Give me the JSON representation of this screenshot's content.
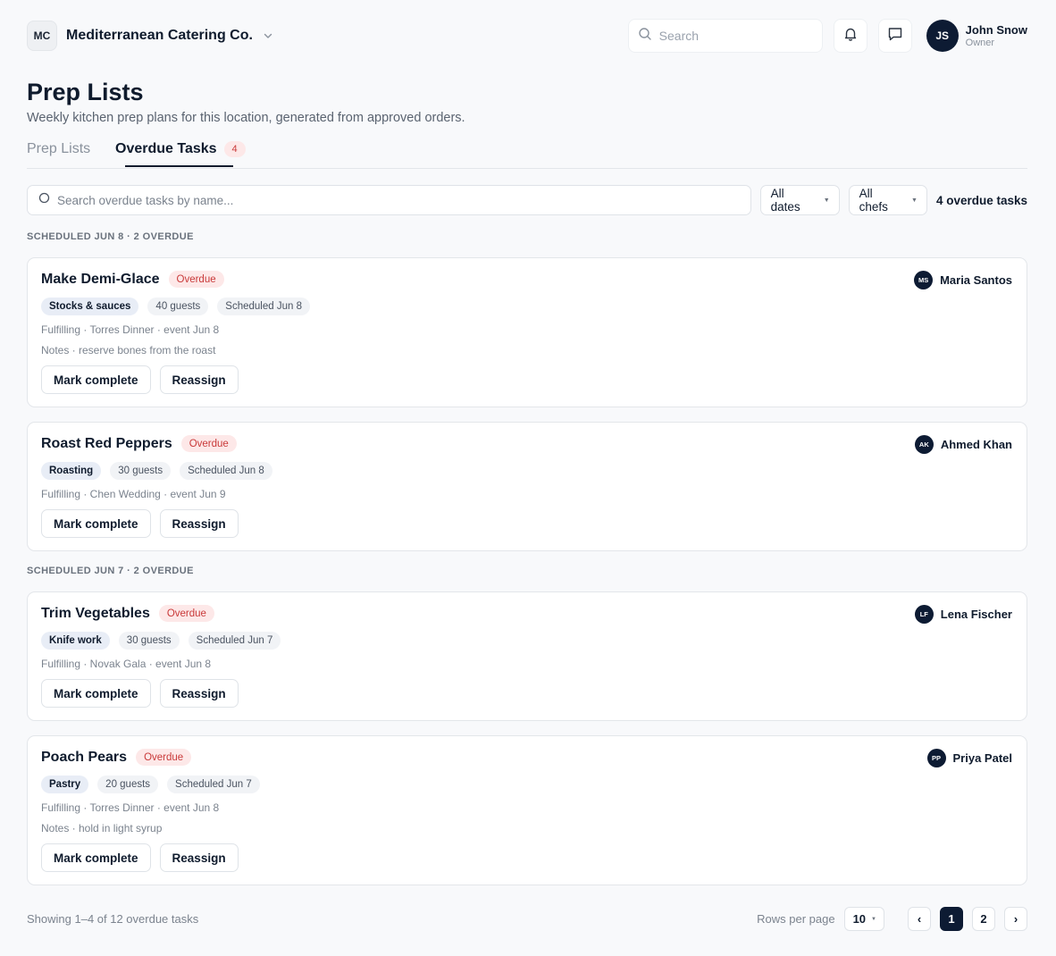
{
  "header": {
    "org_initials": "MC",
    "org_name": "Mediterranean Catering Co.",
    "search_placeholder": "Search",
    "user": {
      "initials": "JS",
      "name": "John Snow",
      "role": "Owner"
    }
  },
  "page": {
    "title": "Prep Lists",
    "subtitle": "Weekly kitchen prep plans for this location, generated from approved orders."
  },
  "tabs": [
    {
      "label": "Prep Lists",
      "active": false
    },
    {
      "label": "Overdue Tasks",
      "active": true,
      "count": "4"
    }
  ],
  "filters": {
    "search_placeholder": "Search overdue tasks by name...",
    "dates": "All dates",
    "chefs": "All chefs",
    "count_label": "4 overdue tasks"
  },
  "groups": [
    {
      "heading": "SCHEDULED JUN 8 · 2 OVERDUE"
    },
    {
      "heading": "SCHEDULED JUN 7 · 2 OVERDUE"
    }
  ],
  "tasks": [
    {
      "title": "Make Demi-Glace",
      "status": "Overdue",
      "assignee_initials": "MS",
      "assignee": "Maria Santos",
      "category": "Stocks & sauces",
      "guests": "40 guests",
      "scheduled": "Scheduled Jun 8",
      "fulfilling": "Fulfilling · Torres Dinner · event Jun 8",
      "notes": "Notes · reserve bones from the roast"
    },
    {
      "title": "Roast Red Peppers",
      "status": "Overdue",
      "assignee_initials": "AK",
      "assignee": "Ahmed Khan",
      "category": "Roasting",
      "guests": "30 guests",
      "scheduled": "Scheduled Jun 8",
      "fulfilling": "Fulfilling · Chen Wedding · event Jun 9",
      "notes": ""
    },
    {
      "title": "Trim Vegetables",
      "status": "Overdue",
      "assignee_initials": "LF",
      "assignee": "Lena Fischer",
      "category": "Knife work",
      "guests": "30 guests",
      "scheduled": "Scheduled Jun 7",
      "fulfilling": "Fulfilling · Novak Gala · event Jun 8",
      "notes": ""
    },
    {
      "title": "Poach Pears",
      "status": "Overdue",
      "assignee_initials": "PP",
      "assignee": "Priya Patel",
      "category": "Pastry",
      "guests": "20 guests",
      "scheduled": "Scheduled Jun 7",
      "fulfilling": "Fulfilling · Torres Dinner · event Jun 8",
      "notes": "Notes · hold in light syrup"
    }
  ],
  "actions": {
    "complete": "Mark complete",
    "reassign": "Reassign"
  },
  "footer": {
    "showing": "Showing 1–4 of 12 overdue tasks",
    "rows_label": "Rows per page",
    "rows_value": "10",
    "prev": "‹",
    "next": "›",
    "pages": [
      "1",
      "2"
    ]
  }
}
